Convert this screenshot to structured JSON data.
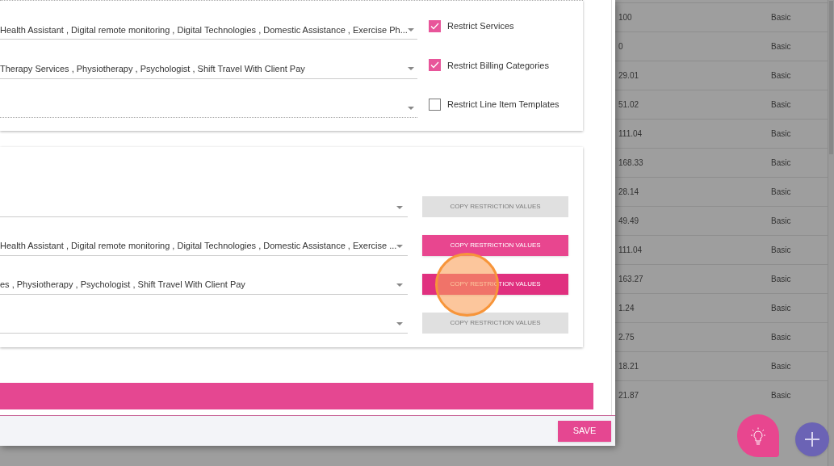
{
  "restriction_card": {
    "rows": [
      {
        "value": "Health Assistant , Digital remote monitoring , Digital Technologies , Domestic Assistance , Exercise Ph...",
        "disabled": false,
        "checkbox": {
          "label": "Restrict Services",
          "checked": true
        }
      },
      {
        "value": "Therapy Services , Physiotherapy , Psychologist , Shift Travel With Client Pay",
        "disabled": false,
        "checkbox": {
          "label": "Restrict Billing Categories",
          "checked": true
        }
      },
      {
        "disabled": true,
        "checkbox": {
          "label": "Restrict Line Item Templates",
          "checked": false
        }
      }
    ]
  },
  "copy_card": {
    "rows": [
      {
        "button": {
          "label": "COPY RESTRICTION VALUES",
          "disabled": true
        }
      },
      {
        "value": "Health Assistant , Digital remote monitoring , Digital Technologies , Domestic Assistance , Exercise ...",
        "button": {
          "label": "COPY RESTRICTION VALUES",
          "disabled": false,
          "hovered": false
        }
      },
      {
        "value": "es , Physiotherapy , Psychologist , Shift Travel With Client Pay",
        "button": {
          "label": "COPY RESTRICTION VALUES",
          "disabled": false,
          "hovered": true
        }
      },
      {
        "button": {
          "label": "COPY RESTRICTION VALUES",
          "disabled": true
        }
      }
    ]
  },
  "save_button": "SAVE",
  "background_table": {
    "rows": [
      {
        "column_1": "100",
        "column_2": "Basic"
      },
      {
        "column_1": "0",
        "column_2": "Basic"
      },
      {
        "column_1": "29.01",
        "column_2": "Basic"
      },
      {
        "column_1": "51.02",
        "column_2": "Basic"
      },
      {
        "column_1": "111.04",
        "column_2": "Basic"
      },
      {
        "column_1": "168.33",
        "column_2": "Basic"
      },
      {
        "column_1": "28.14",
        "column_2": "Basic"
      },
      {
        "column_1": "49.49",
        "column_2": "Basic"
      },
      {
        "column_1": "111.04",
        "column_2": "Basic"
      },
      {
        "column_1": "163.27",
        "column_2": "Basic"
      },
      {
        "column_1": "1.24",
        "column_2": "Basic"
      },
      {
        "column_1": "2.75",
        "column_2": "Basic"
      },
      {
        "column_1": "18.21",
        "column_2": "Basic"
      },
      {
        "column_1": "21.87",
        "column_2": "Basic"
      }
    ]
  }
}
